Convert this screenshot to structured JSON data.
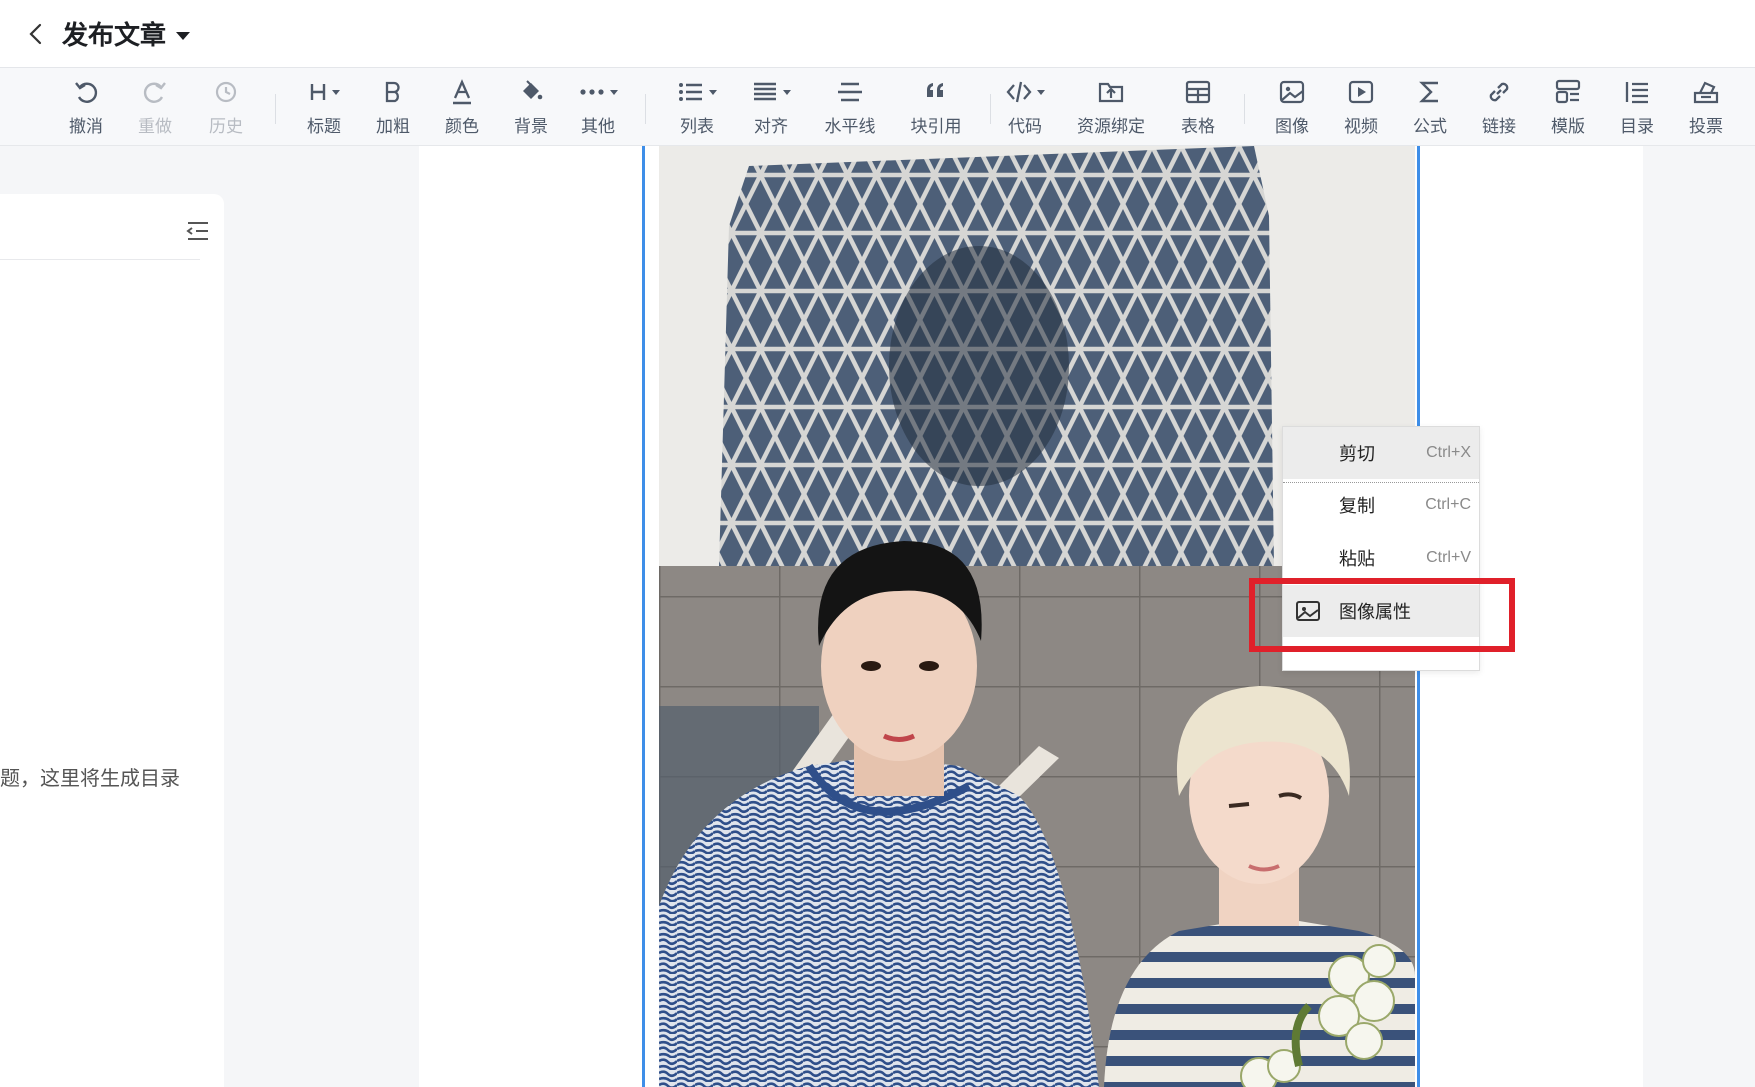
{
  "header": {
    "title": "发布文章"
  },
  "toolbar": {
    "undo": "撤消",
    "redo": "重做",
    "history": "历史",
    "heading": "标题",
    "bold": "加粗",
    "color": "颜色",
    "background": "背景",
    "other": "其他",
    "list": "列表",
    "align": "对齐",
    "hr": "水平线",
    "quote": "块引用",
    "code": "代码",
    "resource": "资源绑定",
    "table": "表格",
    "image": "图像",
    "video": "视频",
    "formula": "公式",
    "link": "链接",
    "template": "模版",
    "toc": "目录",
    "vote": "投票"
  },
  "toc_panel": {
    "empty_text": "题，这里将生成目录"
  },
  "context_menu": {
    "items": [
      {
        "label": "剪切",
        "shortcut": "Ctrl+X"
      },
      {
        "label": "复制",
        "shortcut": "Ctrl+C"
      },
      {
        "label": "粘贴",
        "shortcut": "Ctrl+V"
      },
      {
        "label": "图像属性",
        "shortcut": ""
      }
    ]
  },
  "colors": {
    "accent": "#3e8ee8",
    "highlight": "#e0202a"
  }
}
